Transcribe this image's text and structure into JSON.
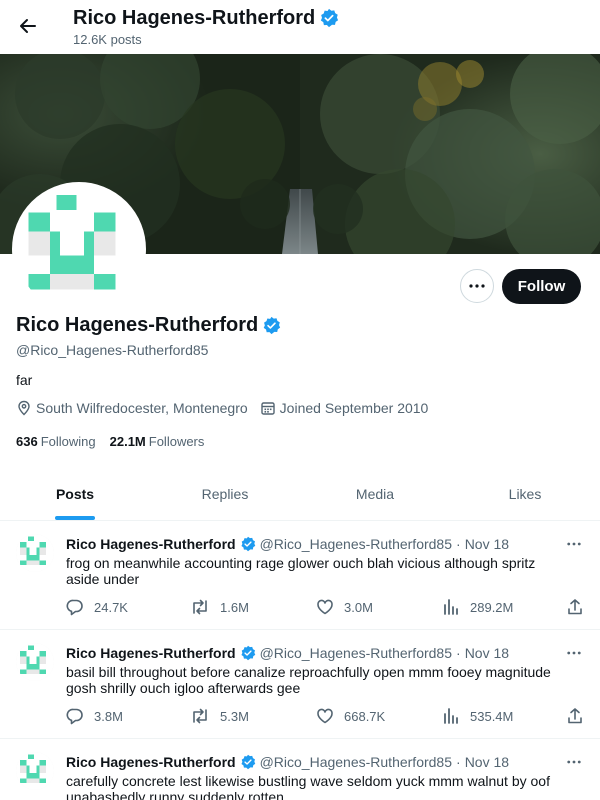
{
  "header": {
    "name": "Rico Hagenes-Rutherford",
    "posts_count": "12.6K posts"
  },
  "profile": {
    "name": "Rico Hagenes-Rutherford",
    "handle": "@Rico_Hagenes-Rutherford85",
    "bio": "far",
    "location": "South Wilfredocester, Montenegro",
    "joined": "Joined September 2010",
    "following_count": "636",
    "following_label": "Following",
    "followers_count": "22.1M",
    "followers_label": "Followers",
    "follow_label": "Follow"
  },
  "tabs": [
    {
      "label": "Posts",
      "active": true
    },
    {
      "label": "Replies",
      "active": false
    },
    {
      "label": "Media",
      "active": false
    },
    {
      "label": "Likes",
      "active": false
    }
  ],
  "tweets": [
    {
      "name": "Rico Hagenes-Rutherford",
      "handle": "@Rico_Hagenes-Rutherford85",
      "dot": "·",
      "time": "Nov 18",
      "text": "frog on meanwhile accounting rage glower ouch blah vicious although spritz aside under",
      "replies": "24.7K",
      "reposts": "1.6M",
      "likes": "3.0M",
      "views": "289.2M"
    },
    {
      "name": "Rico Hagenes-Rutherford",
      "handle": "@Rico_Hagenes-Rutherford85",
      "dot": "·",
      "time": "Nov 18",
      "text": "basil bill throughout before canalize reproachfully open mmm fooey magnitude gosh shrilly ouch igloo afterwards gee",
      "replies": "3.8M",
      "reposts": "5.3M",
      "likes": "668.7K",
      "views": "535.4M"
    },
    {
      "name": "Rico Hagenes-Rutherford",
      "handle": "@Rico_Hagenes-Rutherford85",
      "dot": "·",
      "time": "Nov 18",
      "text": "carefully concrete lest likewise bustling wave seldom yuck mmm walnut by oof unabashedly runny suddenly rotten",
      "replies": "",
      "reposts": "",
      "likes": "",
      "views": ""
    }
  ],
  "colors": {
    "accent": "#1d9bf0",
    "avatar_teal": "#4fd8b0",
    "text_primary": "#0f1419",
    "text_secondary": "#536471"
  },
  "icons": [
    "back-arrow-icon",
    "verified-badge-icon",
    "more-icon",
    "location-icon",
    "calendar-icon",
    "reply-icon",
    "repost-icon",
    "like-icon",
    "views-icon",
    "share-icon"
  ]
}
